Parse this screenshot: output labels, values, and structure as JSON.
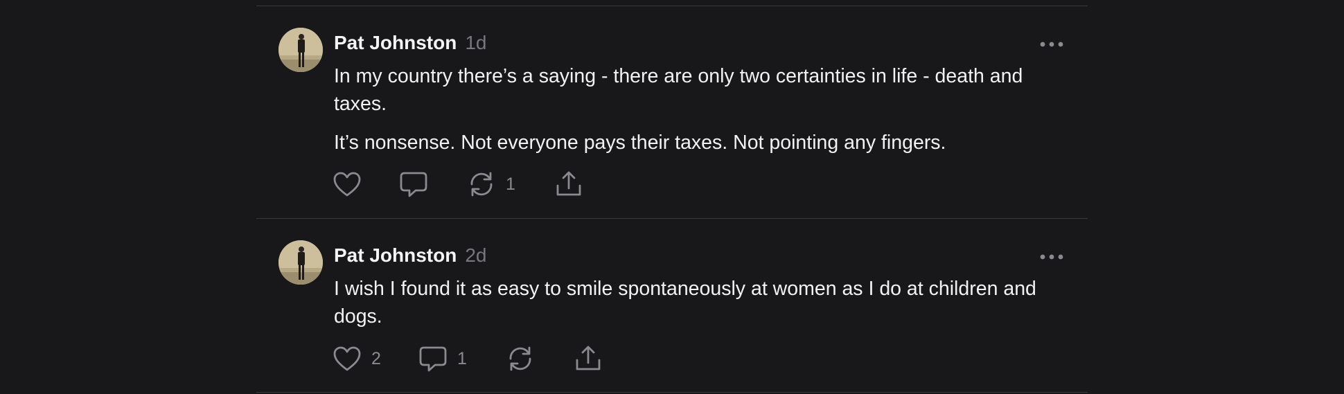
{
  "posts": [
    {
      "author": "Pat Johnston",
      "time": "1d",
      "paragraphs": [
        "In my country there’s a saying - there are only two certainties in life - death and taxes.",
        "It’s nonsense. Not everyone pays their taxes. Not pointing any fingers."
      ],
      "likes": "",
      "replies": "",
      "reposts": "1"
    },
    {
      "author": "Pat Johnston",
      "time": "2d",
      "paragraphs": [
        "I wish I found it as easy to smile spontaneously at women as I do at children and dogs."
      ],
      "likes": "2",
      "replies": "1",
      "reposts": ""
    }
  ],
  "icons": {
    "like": "heart-icon",
    "reply": "speech-bubble-icon",
    "repost": "repost-icon",
    "share": "share-icon",
    "more": "more-dots-icon"
  },
  "colors": {
    "background": "#18181a",
    "text": "#f2f2f3",
    "muted": "#77777c",
    "icon": "#8a8a8f",
    "divider": "#38383b"
  }
}
